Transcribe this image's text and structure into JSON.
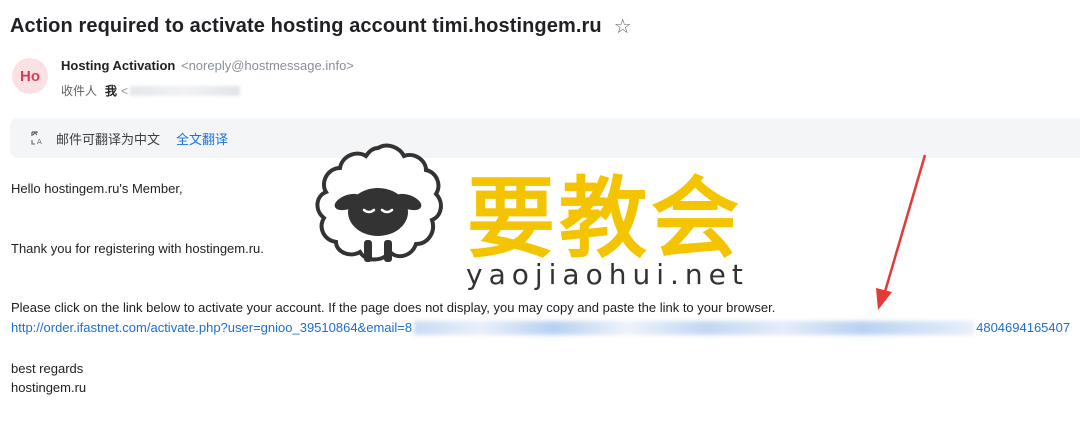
{
  "email": {
    "subject": "Action required to activate hosting account timi.hostingem.ru",
    "sender_initials": "Ho",
    "sender_name": "Hosting Activation",
    "sender_email": "<noreply@hostmessage.info>",
    "recipient_label": "收件人",
    "recipient_me": "我",
    "recipient_addr_prefix": "<"
  },
  "translate_bar": {
    "text": "邮件可翻译为中文",
    "action": "全文翻译"
  },
  "body": {
    "greeting": "Hello hostingem.ru's Member,",
    "thanks": "Thank you for registering with hostingem.ru.",
    "instruction": "Please click on the link below to activate your account. If the page does not display, you may copy and paste the link to your browser.",
    "link_visible_start": "http://order.ifastnet.com/activate.php?user=gnioo_39510864&email=8",
    "link_visible_end": "4804694165407",
    "regards": "best regards",
    "signature": "hostingem.ru"
  },
  "watermark": {
    "title": "要教会",
    "url": "yaojiaohui.net"
  },
  "colors": {
    "link": "#1a6fd0",
    "accent_yellow": "#f5c400",
    "arrow_red": "#e53935",
    "avatar_bg": "#fbe1e4"
  }
}
